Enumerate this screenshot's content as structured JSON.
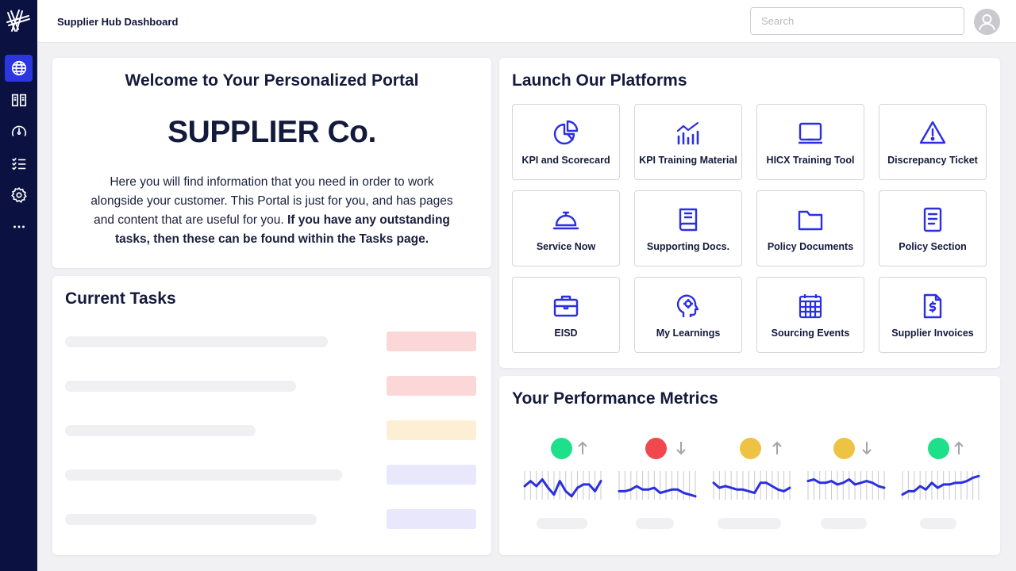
{
  "header": {
    "title": "Supplier Hub Dashboard",
    "search_placeholder": "Search"
  },
  "sidebar": {
    "items": [
      {
        "icon": "globe-icon",
        "active": true
      },
      {
        "icon": "book-icon",
        "active": false
      },
      {
        "icon": "gauge-icon",
        "active": false
      },
      {
        "icon": "checklist-icon",
        "active": false
      },
      {
        "icon": "gear-icon",
        "active": false
      },
      {
        "icon": "more-icon",
        "active": false
      }
    ]
  },
  "welcome": {
    "title": "Welcome to Your Personalized Portal",
    "company": "SUPPLIER Co.",
    "body_regular": "Here you will find information that you need in order to work alongside your customer. This Portal is just for you, and has pages and content that are useful for you.",
    "body_bold": "If you have any outstanding tasks, then these can be found within the Tasks page."
  },
  "tasks": {
    "title": "Current Tasks",
    "pill_colors": [
      "#fcd7d7",
      "#fcd7d7",
      "#fcefd4",
      "#e8e7fb",
      "#e8e7fb"
    ]
  },
  "platforms": {
    "title": "Launch Our Platforms",
    "tiles": [
      {
        "label": "KPI and Scorecard",
        "icon": "pie-chart-icon"
      },
      {
        "label": "KPI Training Material",
        "icon": "bar-chart-icon"
      },
      {
        "label": "HICX Training Tool",
        "icon": "laptop-icon"
      },
      {
        "label": "Discrepancy Ticket",
        "icon": "warning-icon"
      },
      {
        "label": "Service Now",
        "icon": "service-bell-icon"
      },
      {
        "label": "Supporting Docs.",
        "icon": "book-icon"
      },
      {
        "label": "Policy Documents",
        "icon": "folder-icon"
      },
      {
        "label": "Policy Section",
        "icon": "document-icon"
      },
      {
        "label": "EISD",
        "icon": "briefcase-icon"
      },
      {
        "label": "My Learnings",
        "icon": "head-gear-icon"
      },
      {
        "label": "Sourcing Events",
        "icon": "calendar-icon"
      },
      {
        "label": "Supplier Invoices",
        "icon": "invoice-icon"
      }
    ]
  },
  "metrics": {
    "title": "Your Performance Metrics",
    "status_colors": {
      "green": "#1ee08a",
      "red": "#f0484c",
      "yellow": "#eec344"
    },
    "items": [
      {
        "status": "green",
        "trend": "up",
        "values": [
          8,
          11,
          8,
          12,
          7,
          3,
          11,
          5,
          2,
          7,
          9,
          9,
          5,
          11
        ]
      },
      {
        "status": "red",
        "trend": "down",
        "values": [
          5,
          5,
          6,
          8,
          6,
          6,
          7,
          4,
          5,
          6,
          6,
          4,
          3,
          2
        ]
      },
      {
        "status": "yellow",
        "trend": "up",
        "values": [
          10,
          7,
          8,
          7,
          6,
          6,
          5,
          4,
          10,
          10,
          8,
          6,
          5,
          7
        ]
      },
      {
        "status": "yellow",
        "trend": "down",
        "values": [
          11,
          12,
          10,
          10,
          11,
          9,
          10,
          12,
          9,
          10,
          11,
          10,
          8,
          7
        ]
      },
      {
        "status": "green",
        "trend": "up",
        "values": [
          3,
          5,
          5,
          8,
          6,
          10,
          7,
          9,
          9,
          10,
          10,
          11,
          13,
          14
        ]
      }
    ]
  }
}
